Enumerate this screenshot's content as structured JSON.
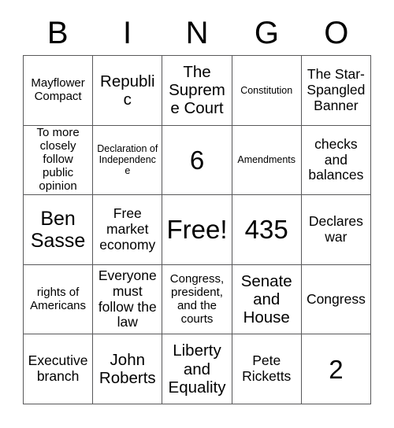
{
  "card": {
    "header_letters": [
      "B",
      "I",
      "N",
      "G",
      "O"
    ],
    "border_color": "#58585a",
    "background_color": "#ffffff",
    "text_color": "#000000",
    "rows": 5,
    "columns": 5,
    "cells": [
      [
        {
          "text": "Mayflower Compact",
          "size": "sm"
        },
        {
          "text": "Republic",
          "size": "lg"
        },
        {
          "text": "The Supreme Court",
          "size": "lg"
        },
        {
          "text": "Constitution",
          "size": "xs"
        },
        {
          "text": "The Star-Spangled Banner",
          "size": "md"
        }
      ],
      [
        {
          "text": "To more closely follow public opinion",
          "size": "sm"
        },
        {
          "text": "Declaration of Independence",
          "size": "xs"
        },
        {
          "text": "6",
          "size": "xxl"
        },
        {
          "text": "Amendments",
          "size": "xs"
        },
        {
          "text": "checks and balances",
          "size": "md"
        }
      ],
      [
        {
          "text": "Ben Sasse",
          "size": "xl"
        },
        {
          "text": "Free market economy",
          "size": "md"
        },
        {
          "text": "Free!",
          "size": "xxl"
        },
        {
          "text": "435",
          "size": "xxl"
        },
        {
          "text": "Declares war",
          "size": "md"
        }
      ],
      [
        {
          "text": "rights of Americans",
          "size": "sm"
        },
        {
          "text": "Everyone must follow the law",
          "size": "md"
        },
        {
          "text": "Congress, president, and the courts",
          "size": "sm"
        },
        {
          "text": "Senate and House",
          "size": "lg"
        },
        {
          "text": "Congress",
          "size": "md"
        }
      ],
      [
        {
          "text": "Executive branch",
          "size": "md"
        },
        {
          "text": "John Roberts",
          "size": "lg"
        },
        {
          "text": "Liberty and Equality",
          "size": "lg"
        },
        {
          "text": "Pete Ricketts",
          "size": "md"
        },
        {
          "text": "2",
          "size": "xxl"
        }
      ]
    ]
  }
}
